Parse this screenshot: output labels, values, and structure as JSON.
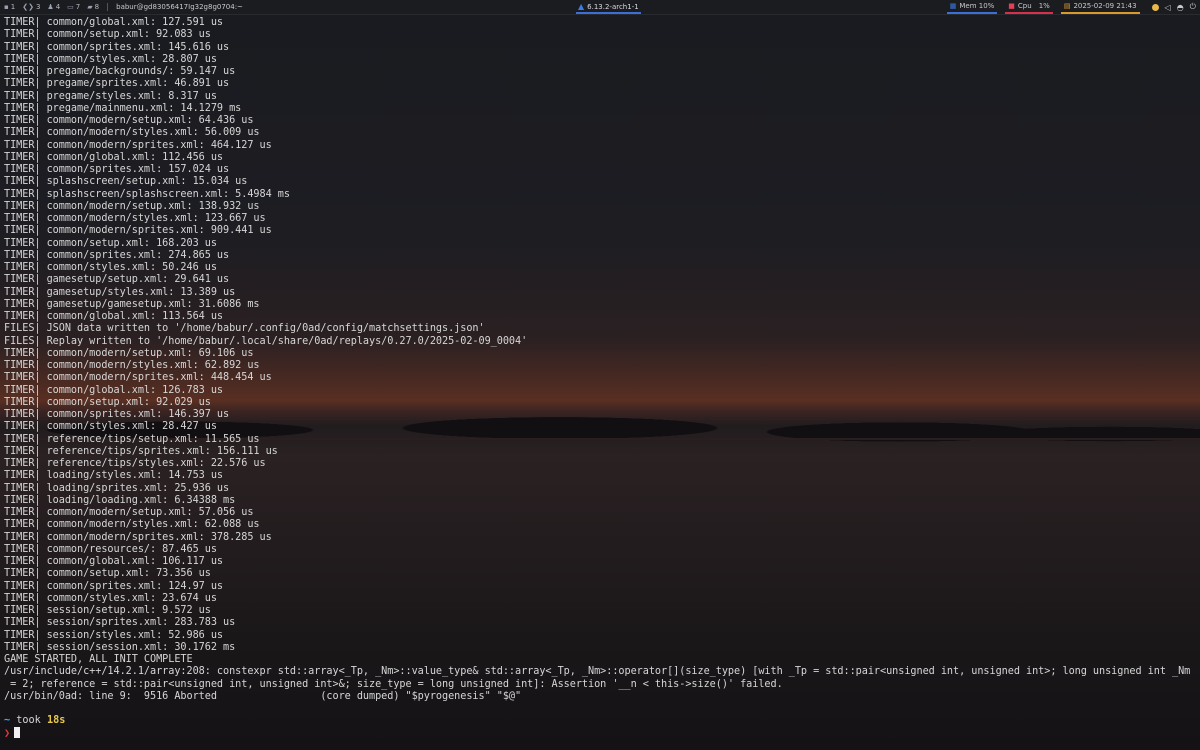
{
  "panel": {
    "workspaces": [
      {
        "icon": "terminal-icon",
        "glyph": "▪",
        "label": "1"
      },
      {
        "icon": "code-icon",
        "glyph": "❮❯",
        "label": "3"
      },
      {
        "icon": "user-icon",
        "glyph": "♟",
        "label": "4"
      },
      {
        "icon": "monitor-icon",
        "glyph": "▭",
        "label": "7"
      },
      {
        "icon": "folder-icon",
        "glyph": "▰",
        "label": "8"
      }
    ],
    "window_title": "babur@gd830564​17Ig32g8g0704:~",
    "kernel": "6.13.2-arch1-1",
    "mem": "Mem 10%",
    "cpu_label": "Cpu",
    "cpu_value": "1%",
    "datetime": "2025-02-09 21:43",
    "colors": {
      "mem": "#3b6fd6",
      "cpu": "#d6304a",
      "date": "#d99a2b",
      "kernel": "#3b6fd6"
    }
  },
  "terminal": {
    "lines": [
      "TIMER| common/global.xml: 127.591 us",
      "TIMER| common/setup.xml: 92.083 us",
      "TIMER| common/sprites.xml: 145.616 us",
      "TIMER| common/styles.xml: 28.807 us",
      "TIMER| pregame/backgrounds/: 59.147 us",
      "TIMER| pregame/sprites.xml: 46.891 us",
      "TIMER| pregame/styles.xml: 8.317 us",
      "TIMER| pregame/mainmenu.xml: 14.1279 ms",
      "TIMER| common/modern/setup.xml: 64.436 us",
      "TIMER| common/modern/styles.xml: 56.009 us",
      "TIMER| common/modern/sprites.xml: 464.127 us",
      "TIMER| common/global.xml: 112.456 us",
      "TIMER| common/sprites.xml: 157.024 us",
      "TIMER| splashscreen/setup.xml: 15.034 us",
      "TIMER| splashscreen/splashscreen.xml: 5.4984 ms",
      "TIMER| common/modern/setup.xml: 138.932 us",
      "TIMER| common/modern/styles.xml: 123.667 us",
      "TIMER| common/modern/sprites.xml: 909.441 us",
      "TIMER| common/setup.xml: 168.203 us",
      "TIMER| common/sprites.xml: 274.865 us",
      "TIMER| common/styles.xml: 50.246 us",
      "TIMER| gamesetup/setup.xml: 29.641 us",
      "TIMER| gamesetup/styles.xml: 13.389 us",
      "TIMER| gamesetup/gamesetup.xml: 31.6086 ms",
      "TIMER| common/global.xml: 113.564 us",
      "FILES| JSON data written to '/home/babur/.config/0ad/config/matchsettings.json'",
      "FILES| Replay written to '/home/babur/.local/share/0ad/replays/0.27.0/2025-02-09_0004'",
      "TIMER| common/modern/setup.xml: 69.106 us",
      "TIMER| common/modern/styles.xml: 62.892 us",
      "TIMER| common/modern/sprites.xml: 448.454 us",
      "TIMER| common/global.xml: 126.783 us",
      "TIMER| common/setup.xml: 92.029 us",
      "TIMER| common/sprites.xml: 146.397 us",
      "TIMER| common/styles.xml: 28.427 us",
      "TIMER| reference/tips/setup.xml: 11.565 us",
      "TIMER| reference/tips/sprites.xml: 156.111 us",
      "TIMER| reference/tips/styles.xml: 22.576 us",
      "TIMER| loading/styles.xml: 14.753 us",
      "TIMER| loading/sprites.xml: 25.936 us",
      "TIMER| loading/loading.xml: 6.34388 ms",
      "TIMER| common/modern/setup.xml: 57.056 us",
      "TIMER| common/modern/styles.xml: 62.088 us",
      "TIMER| common/modern/sprites.xml: 378.285 us",
      "TIMER| common/resources/: 87.465 us",
      "TIMER| common/global.xml: 106.117 us",
      "TIMER| common/setup.xml: 73.356 us",
      "TIMER| common/sprites.xml: 124.97 us",
      "TIMER| common/styles.xml: 23.674 us",
      "TIMER| session/setup.xml: 9.572 us",
      "TIMER| session/sprites.xml: 283.783 us",
      "TIMER| session/styles.xml: 52.986 us",
      "TIMER| session/session.xml: 30.1762 ms",
      "GAME STARTED, ALL INIT COMPLETE",
      "/usr/include/c++/14.2.1/array:208: constexpr std::array<_Tp, _Nm>::value_type& std::array<_Tp, _Nm>::operator[](size_type) [with _Tp = std::pair<unsigned int, unsigned int>; long unsigned int _Nm",
      " = 2; reference = std::pair<unsigned int, unsigned int>&; size_type = long unsigned int]: Assertion '__n < this->size()' failed.",
      "/usr/bin/0ad: line 9:  9516 Aborted                 (core dumped) \"$pyrogenesis\" \"$@\""
    ],
    "prompt": {
      "tilde": "~",
      "took": "took",
      "duration": "18s",
      "arrow": "❯"
    }
  }
}
